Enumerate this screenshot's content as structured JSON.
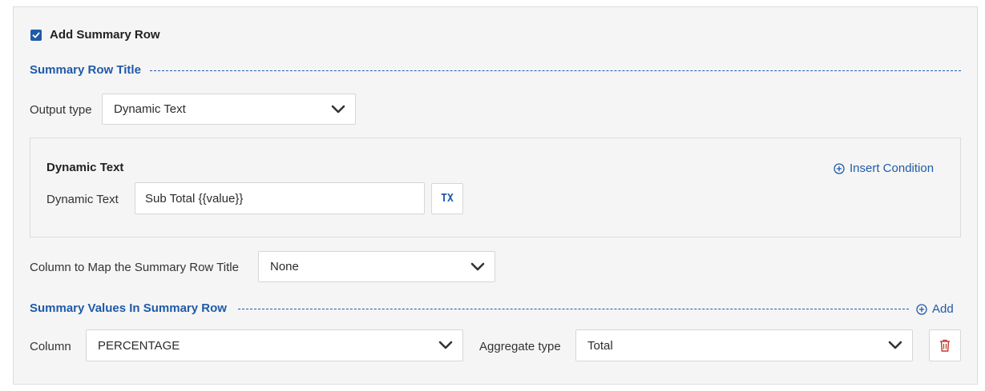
{
  "summary_row": {
    "checkbox_label": "Add Summary Row",
    "checked": true
  },
  "title_section": {
    "heading": "Summary Row Title",
    "output_type_label": "Output type",
    "output_type_value": "Dynamic Text"
  },
  "dynamic_text": {
    "heading": "Dynamic Text",
    "insert_condition_label": "Insert Condition",
    "field_label": "Dynamic Text",
    "field_value": "Sub Total {{value}}",
    "tx_button_label": "TX"
  },
  "column_map": {
    "label": "Column to Map the Summary Row Title",
    "value": "None"
  },
  "values_section": {
    "heading": "Summary Values In Summary Row",
    "add_label": "Add",
    "column_label": "Column",
    "column_value": "PERCENTAGE",
    "aggregate_label": "Aggregate type",
    "aggregate_value": "Total"
  },
  "icons": {
    "checkbox": "checkmark-icon",
    "dropdown": "chevron-down-icon",
    "insert": "plus-circle-icon",
    "add": "plus-circle-icon",
    "delete": "trash-icon"
  },
  "colors": {
    "accent": "#1f5aa8",
    "danger": "#c0392b",
    "panel_bg": "#f5f5f5"
  }
}
